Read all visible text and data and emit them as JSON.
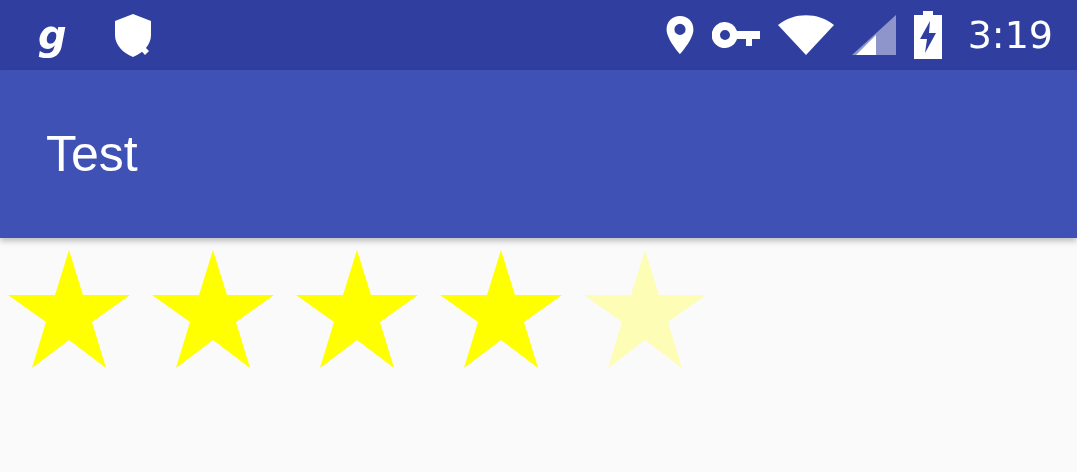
{
  "status_bar": {
    "notification_glyph": "g",
    "time": "3:19"
  },
  "toolbar": {
    "title": "Test"
  },
  "rating": {
    "stars": 4
  }
}
